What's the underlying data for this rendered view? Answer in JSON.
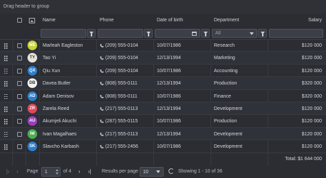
{
  "group_panel": {
    "hint": "Drag header to group"
  },
  "columns": {
    "name": "Name",
    "phone": "Phone",
    "dob": "Date of birth",
    "department": "Department",
    "salary": "Salary"
  },
  "filters": {
    "department_value": "All"
  },
  "rows": [
    {
      "initials": "ME",
      "avatar_color": "#c6d23a",
      "name": "Marleah Eagleston",
      "phone": "(209) 555-0104",
      "dob": "10/07/1986",
      "department": "Research",
      "salary": "$120 000"
    },
    {
      "initials": "TY",
      "avatar_color": "#e8e2d8",
      "name": "Tao Yi",
      "phone": "(209) 555-0104",
      "dob": "12/13/1994",
      "department": "Marketing",
      "salary": "$120 000"
    },
    {
      "initials": "QX",
      "avatar_color": "#2e7ec9",
      "name": "Qiu Xun",
      "phone": "(209) 555-0104",
      "dob": "10/07/1986",
      "department": "Accounting",
      "salary": "$120 000"
    },
    {
      "initials": "DB",
      "avatar_color": "#f2f2f2",
      "name": "Davea Butler",
      "phone": "(808) 555-0111",
      "dob": "12/13/1994",
      "department": "Production",
      "salary": "$320 000"
    },
    {
      "initials": "AD",
      "avatar_color": "#2e7ec9",
      "name": "Adam Denisov",
      "phone": "(808) 555-0111",
      "dob": "10/07/1986",
      "department": "Finance",
      "salary": "$320 000"
    },
    {
      "initials": "ZR",
      "avatar_color": "#e0475b",
      "name": "Zarela Reed",
      "phone": "(217) 555-0113",
      "dob": "12/13/1994",
      "department": "Development",
      "salary": "$120 000"
    },
    {
      "initials": "AU",
      "avatar_color": "#9a3fb8",
      "name": "Akumjeli Akuchi",
      "phone": "(287) 555-0115",
      "dob": "10/07/1986",
      "department": "Production",
      "salary": "$120 000"
    },
    {
      "initials": "IM",
      "avatar_color": "#4caf50",
      "name": "Ivan Magalhaes",
      "phone": "(217) 555-0113",
      "dob": "12/13/1994",
      "department": "Development",
      "salary": "$120 000"
    },
    {
      "initials": "SK",
      "avatar_color": "#2e7ec9",
      "name": "Slavcho Karbash",
      "phone": "(217) 555-2456",
      "dob": "10/07/1986",
      "department": "Development",
      "salary": "$120 000"
    }
  ],
  "summary": {
    "total_label": "Total: $1 644 000"
  },
  "pager": {
    "page_label": "Page",
    "page_value": "1",
    "of_label": "of 4",
    "results_label": "Results per page",
    "results_value": "10",
    "showing_label": "Showing 1 - 10 of 36"
  },
  "icons": {
    "filter": "funnel-icon",
    "calendar": "calendar-icon",
    "phone": "phone-icon",
    "image": "image-icon",
    "drag": "drag-handle-icon",
    "refresh": "refresh-icon"
  }
}
